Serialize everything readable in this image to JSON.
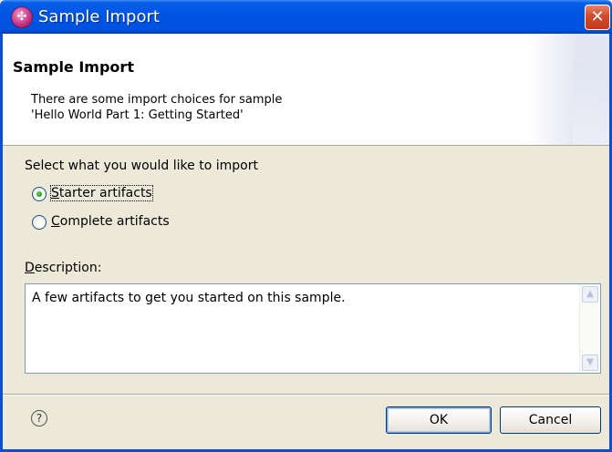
{
  "window": {
    "title": "Sample Import",
    "close_glyph": "✕"
  },
  "banner": {
    "title": "Sample Import",
    "description_line1": "There are some import choices for sample",
    "description_line2": "'Hello World Part 1: Getting Started'"
  },
  "options": {
    "prompt": "Select what you would like to import",
    "starter": {
      "mnemonic": "S",
      "rest": "tarter artifacts",
      "selected": true
    },
    "complete": {
      "mnemonic": "C",
      "rest": "omplete artifacts",
      "selected": false
    }
  },
  "description": {
    "label_mnemonic": "D",
    "label_rest": "escription:",
    "text": "A few artifacts to get you started on this sample."
  },
  "footer": {
    "help_glyph": "?",
    "ok_label": "OK",
    "cancel_label": "Cancel"
  },
  "icons": {
    "app": "sample-import-icon",
    "close": "close-icon",
    "help": "help-icon",
    "scroll_up": "scroll-up-icon",
    "scroll_down": "scroll-down-icon"
  },
  "colors": {
    "titlebar": "#0055e5",
    "dialog_bg": "#ece9d8",
    "close_button": "#d24a2b",
    "radio_selected": "#1f9a1a"
  }
}
